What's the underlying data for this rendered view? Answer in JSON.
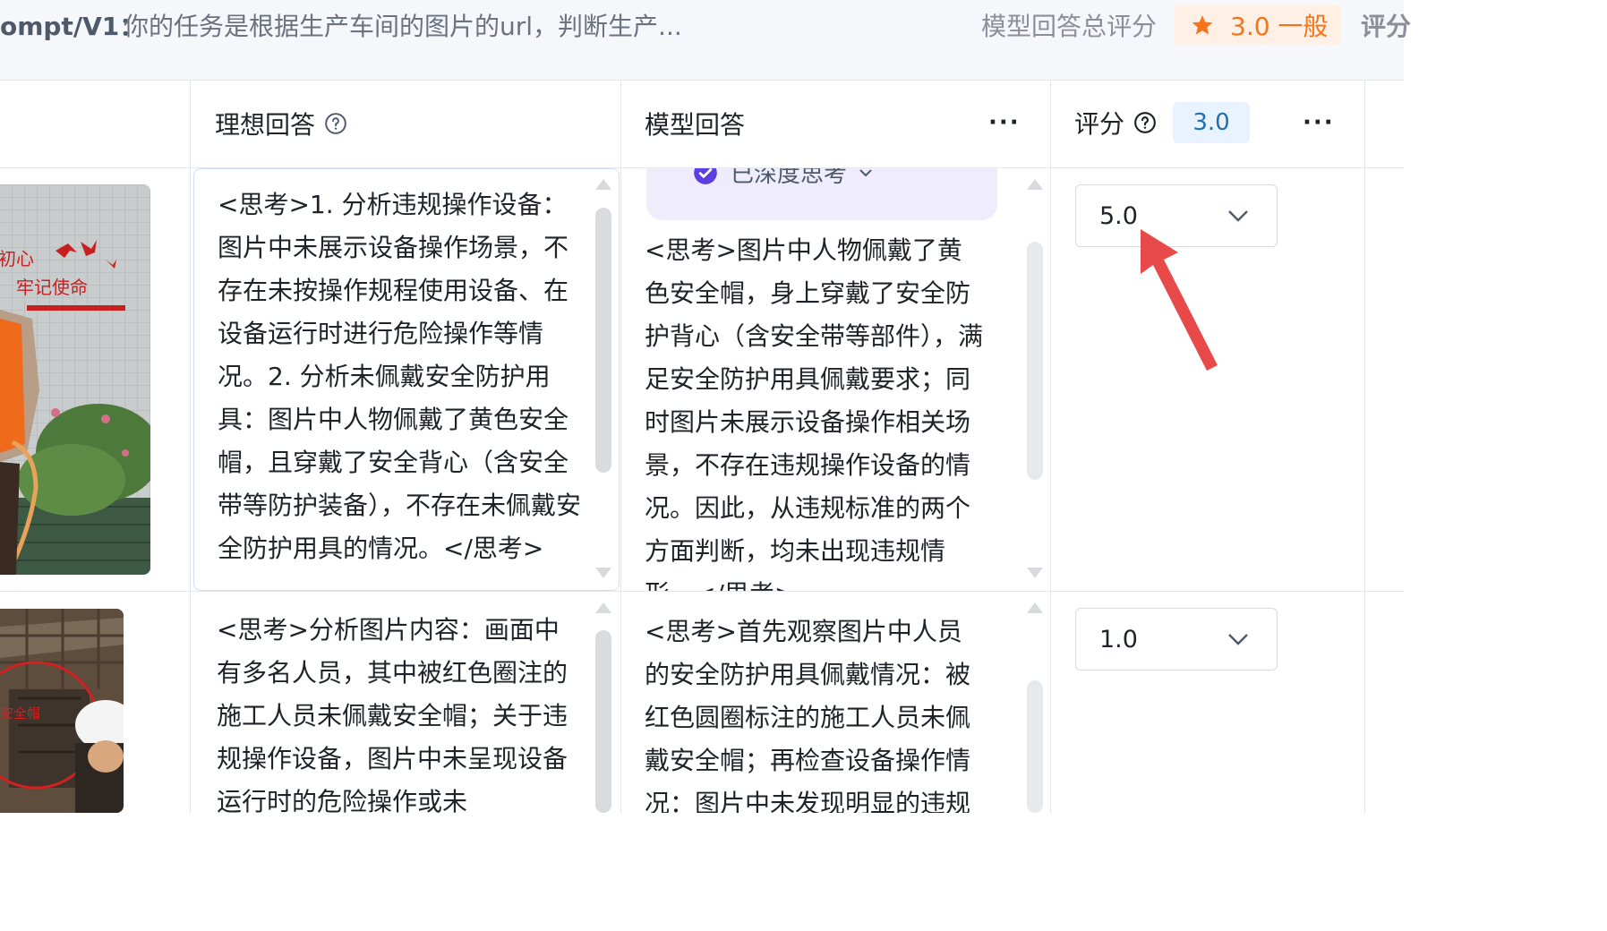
{
  "topbar": {
    "prompt_name": "ompt/V1：",
    "prompt_text": "你的任务是根据生产车间的图片的url，判断生产...",
    "overall_label": "模型回答总评分",
    "overall_score": "3.0 一般",
    "score_cut": "评分"
  },
  "header": {
    "ideal_label": "理想回答",
    "model_label": "模型回答",
    "score_label": "评分",
    "score_avg": "3.0",
    "more_glyph": "···"
  },
  "rows": [
    {
      "ideal_answer": "<思考>1. 分析违规操作设备：图片中未展示设备操作场景，不存在未按操作规程使用设备、在设备运行时进行危险操作等情况。2. 分析未佩戴安全防护用具：图片中人物佩戴了黄色安全帽，且穿戴了安全背心（含安全带等防护装备），不存在未佩戴安全防护用具的情况。</思考>",
      "think_chip": "已深度思考",
      "model_answer": "<思考>图片中人物佩戴了黄色安全帽，身上穿戴了安全防护背心（含安全带等部件），满足安全防护用具佩戴要求；同时图片未展示设备操作相关场景，不存在违规操作设备的情况。因此，从违规标准的两个方面判断，均未出现违规情形。</思考>",
      "score": "5.0",
      "image_banner_1": "初心",
      "image_banner_2": "牢记使命"
    },
    {
      "ideal_answer": "<思考>分析图片内容：画面中有多名人员，其中被红色圈注的施工人员未佩戴安全帽；关于违规操作设备，图片中未呈现设备运行时的危险操作或未",
      "model_answer": "<思考>首先观察图片中人员的安全防护用具佩戴情况：被红色圆圈标注的施工人员未佩戴安全帽；再检查设备操作情况：图片中未发现明显的违规",
      "score": "1.0",
      "image_label": "安全帽"
    }
  ],
  "colors": {
    "accent_orange": "#f5741c",
    "badge_blue": "#1f6fb2",
    "annotation_red": "#e84a4a"
  },
  "icons": [
    "star-icon",
    "help-icon",
    "more-icon",
    "check-circle-icon",
    "chevron-down-icon",
    "red-annotation-arrow"
  ]
}
